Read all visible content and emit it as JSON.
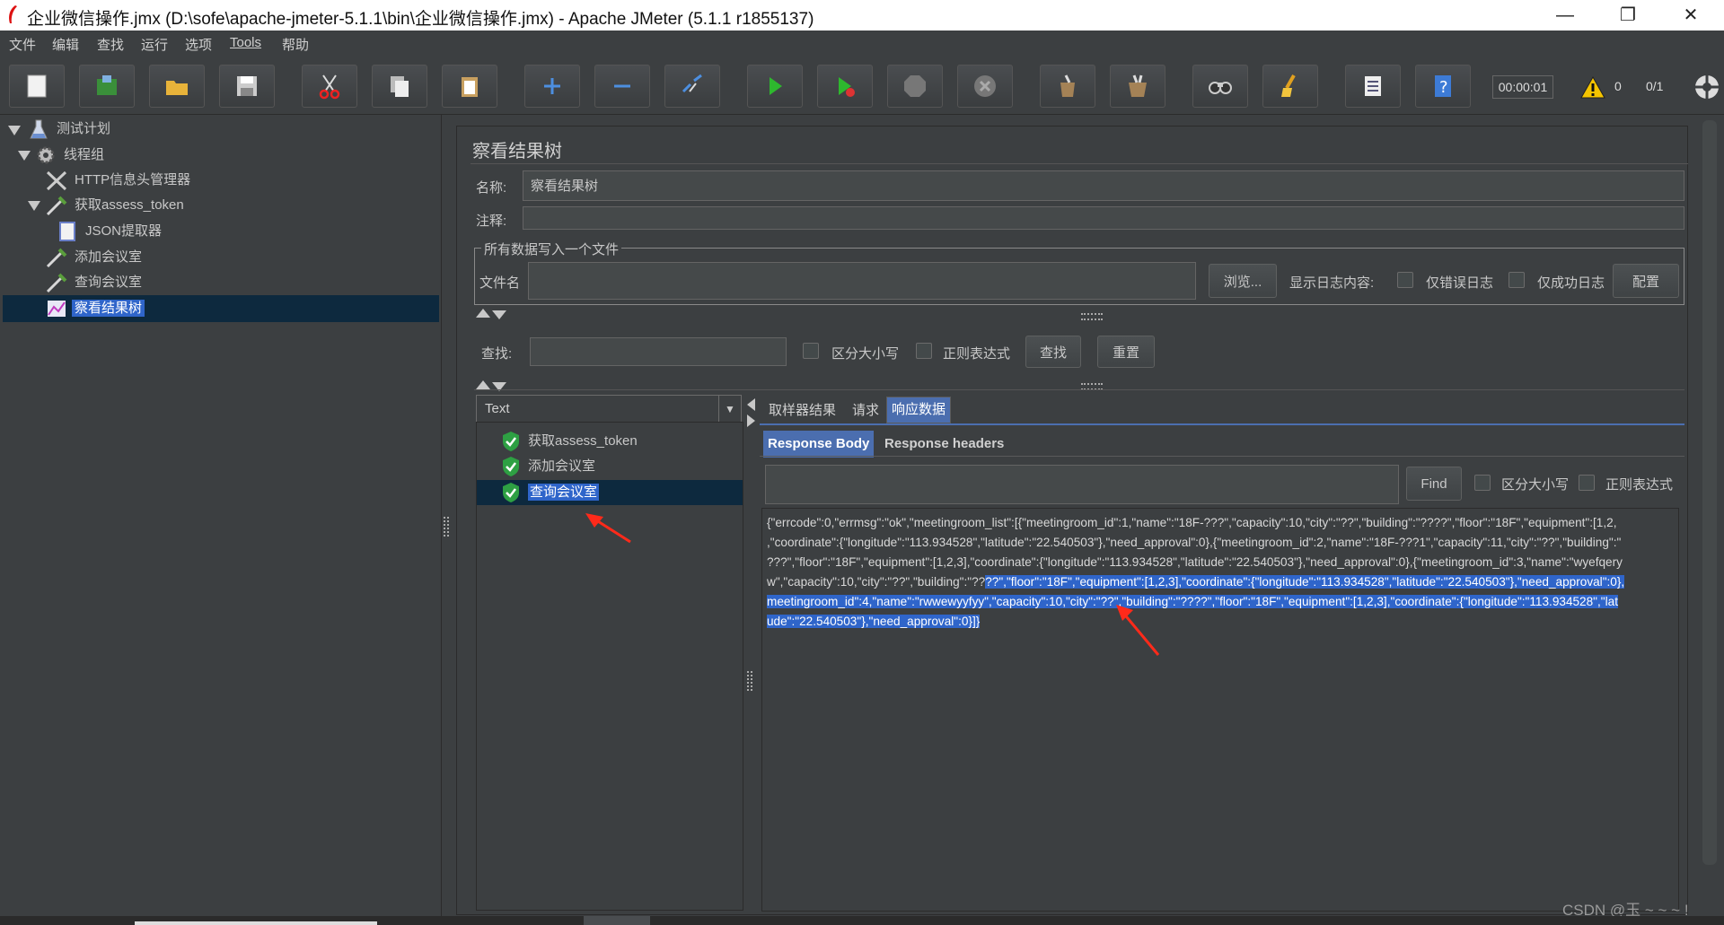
{
  "window": {
    "title": "企业微信操作.jmx (D:\\sofe\\apache-jmeter-5.1.1\\bin\\企业微信操作.jmx) - Apache JMeter (5.1.1 r1855137)",
    "minimize": "—",
    "maximize": "❐",
    "close": "✕"
  },
  "menu": [
    "文件",
    "编辑",
    "查找",
    "运行",
    "选项",
    "Tools",
    "帮助"
  ],
  "toolbar": {
    "buttons": [
      "new-icon",
      "templates-icon",
      "open-icon",
      "save-icon",
      "cut-icon",
      "copy-icon",
      "paste-icon",
      "expand-icon",
      "collapse-icon",
      "toggle-icon",
      "start-icon",
      "start-no-pause-icon",
      "stop-icon",
      "shutdown-icon",
      "clear-icon",
      "clear-all-icon",
      "search-icon",
      "reset-search-icon",
      "function-helper-icon",
      "help-icon"
    ],
    "timer": "00:00:01",
    "warnings": "0",
    "threads": "0/1"
  },
  "tree": {
    "items": [
      {
        "label": "测试计划",
        "icon": "flask-icon"
      },
      {
        "label": "线程组",
        "icon": "gear-icon"
      },
      {
        "label": "HTTP信息头管理器",
        "icon": "tools-icon"
      },
      {
        "label": "获取assess_token",
        "icon": "sampler-icon"
      },
      {
        "label": "JSON提取器",
        "icon": "document-icon"
      },
      {
        "label": "添加会议室",
        "icon": "sampler-icon"
      },
      {
        "label": "查询会议室",
        "icon": "sampler-icon"
      },
      {
        "label": "察看结果树",
        "icon": "chart-icon"
      }
    ]
  },
  "panel": {
    "title": "察看结果树",
    "name_label": "名称:",
    "name_value": "察看结果树",
    "comment_label": "注释:",
    "file_group": "所有数据写入一个文件",
    "filename_label": "文件名",
    "browse": "浏览...",
    "log_display": "显示日志内容:",
    "errors_only": "仅错误日志",
    "success_only": "仅成功日志",
    "configure": "配置",
    "search_label": "查找:",
    "case_sensitive": "区分大小写",
    "regex": "正则表达式",
    "search_btn": "查找",
    "reset_btn": "重置",
    "renderer": "Text"
  },
  "results": [
    "获取assess_token",
    "添加会议室",
    "查询会议室"
  ],
  "tabs": [
    "取样器结果",
    "请求",
    "响应数据"
  ],
  "subtabs": [
    "Response Body",
    "Response headers"
  ],
  "find": {
    "button": "Find",
    "case_sensitive": "区分大小写",
    "regex": "正则表达式"
  },
  "response_lines": [
    {
      "a": "{\"errcode\":0,\"errmsg\":\"ok\",\"meetingroom_list\":[{\"meetingroom_id\":1,\"name\":\"18F-???\",\"capacity\":10,\"city\":\"??\",\"building\":\"????\",\"floor\":\"18F\",\"equipment\":[1,2,",
      "b": ""
    },
    {
      "a": ",\"coordinate\":{\"longitude\":\"113.934528\",\"latitude\":\"22.540503\"},\"need_approval\":0},{\"meetingroom_id\":2,\"name\":\"18F-???1\",\"capacity\":11,\"city\":\"??\",\"building\":\"",
      "b": ""
    },
    {
      "a": "???\",\"floor\":\"18F\",\"equipment\":[1,2,3],\"coordinate\":{\"longitude\":\"113.934528\",\"latitude\":\"22.540503\"},\"need_approval\":0},{\"meetingroom_id\":3,\"name\":\"wyefqery",
      "b": ""
    },
    {
      "a": "w\",\"capacity\":10,\"city\":\"??\",\"building\":\"??",
      "b": "??\",\"floor\":\"18F\",\"equipment\":[1,2,3],\"coordinate\":{\"longitude\":\"113.934528\",\"latitude\":\"22.540503\"},\"need_approval\":0},"
    },
    {
      "a": "",
      "b": "meetingroom_id\":4,\"name\":\"rwwewyyfyy\",\"capacity\":10,\"city\":\"??\",\"building\":\"????\",\"floor\":\"18F\",\"equipment\":[1,2,3],\"coordinate\":{\"longitude\":\"113.934528\",\"lat"
    },
    {
      "a": "",
      "b": "ude\":\"22.540503\"},\"need_approval\":0}]}"
    }
  ],
  "watermark": "CSDN @玉 ~ ~ ~ !",
  "colors": {
    "background": "#3c3f41",
    "selection": "#2f65ca",
    "tree_selection": "#0d293e",
    "success": "#2ea043",
    "annotation": "#ff2a1a"
  }
}
